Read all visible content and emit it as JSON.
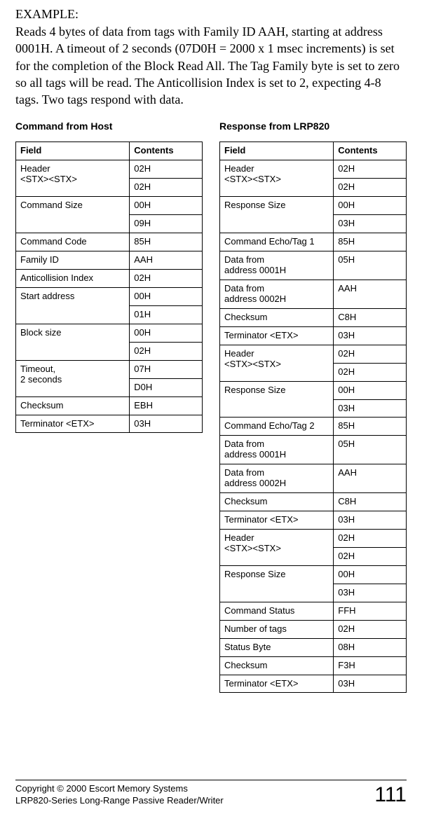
{
  "example_label": "EXAMPLE:",
  "paragraph": "Reads 4 bytes of data from tags with Family ID AAH, starting at address 0001H. A timeout of 2 seconds (07D0H = 2000 x 1 msec increments) is set for the completion of the Block Read All. The Tag Family byte is set to zero so all tags will be read.  The Anticollision Index is set to 2, expecting 4-8 tags.  Two tags respond with data.",
  "left": {
    "title": "Command from Host",
    "header_field": "Field",
    "header_contents": "Contents",
    "rows": [
      {
        "field": "Header\n<STX><STX>",
        "contents": "02H",
        "rowspan": 2
      },
      {
        "contents": "02H"
      },
      {
        "field": "Command Size",
        "contents": "00H",
        "rowspan": 2
      },
      {
        "contents": "09H"
      },
      {
        "field": "Command Code",
        "contents": "85H"
      },
      {
        "field": "Family ID",
        "contents": "AAH"
      },
      {
        "field": "Anticollision Index",
        "contents": "02H"
      },
      {
        "field": "Start address",
        "contents": "00H",
        "rowspan": 2
      },
      {
        "contents": "01H"
      },
      {
        "field": "Block size",
        "contents": "00H",
        "rowspan": 2
      },
      {
        "contents": "02H"
      },
      {
        "field": "Timeout,\n2 seconds",
        "contents": "07H",
        "rowspan": 2
      },
      {
        "contents": "D0H"
      },
      {
        "field": "Checksum",
        "contents": "EBH"
      },
      {
        "field": "Terminator <ETX>",
        "contents": "03H"
      }
    ]
  },
  "right": {
    "title": "Response from LRP820",
    "header_field": "Field",
    "header_contents": "Contents",
    "rows": [
      {
        "field": "Header\n<STX><STX>",
        "contents": "02H",
        "rowspan": 2
      },
      {
        "contents": "02H"
      },
      {
        "field": "Response Size",
        "contents": "00H",
        "rowspan": 2
      },
      {
        "contents": "03H"
      },
      {
        "field": "Command Echo/Tag 1",
        "contents": "85H"
      },
      {
        "field": "Data from\naddress 0001H",
        "contents": "05H"
      },
      {
        "field": "Data from\naddress 0002H",
        "contents": "AAH"
      },
      {
        "field": "Checksum",
        "contents": "C8H"
      },
      {
        "field": "Terminator <ETX>",
        "contents": "03H"
      },
      {
        "field": "Header\n<STX><STX>",
        "contents": "02H",
        "rowspan": 2
      },
      {
        "contents": "02H"
      },
      {
        "field": "Response Size",
        "contents": "00H",
        "rowspan": 2
      },
      {
        "contents": "03H"
      },
      {
        "field": "Command Echo/Tag 2",
        "contents": "85H"
      },
      {
        "field": "Data from\naddress 0001H",
        "contents": "05H"
      },
      {
        "field": "Data from\naddress 0002H",
        "contents": "AAH"
      },
      {
        "field": "Checksum",
        "contents": "C8H"
      },
      {
        "field": "Terminator <ETX>",
        "contents": "03H"
      },
      {
        "field": "Header\n<STX><STX>",
        "contents": "02H",
        "rowspan": 2
      },
      {
        "contents": "02H"
      },
      {
        "field": "Response Size",
        "contents": "00H",
        "rowspan": 2
      },
      {
        "contents": "03H"
      },
      {
        "field": "Command Status",
        "contents": "FFH"
      },
      {
        "field": "Number of tags",
        "contents": "02H"
      },
      {
        "field": "Status Byte",
        "contents": "08H"
      },
      {
        "field": "Checksum",
        "contents": "F3H"
      },
      {
        "field": "Terminator <ETX>",
        "contents": "03H"
      }
    ]
  },
  "footer": {
    "line1": "Copyright © 2000 Escort Memory Systems",
    "line2": "LRP820-Series Long-Range Passive Reader/Writer",
    "page": "111"
  }
}
